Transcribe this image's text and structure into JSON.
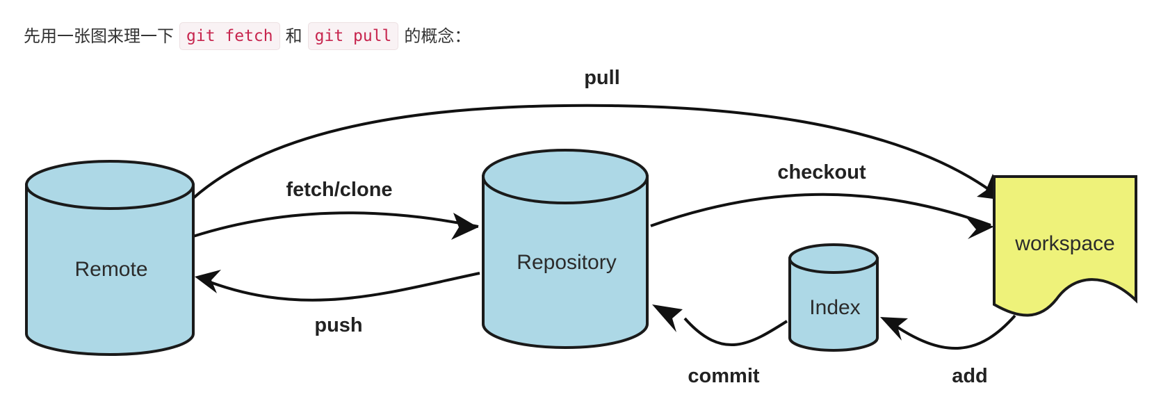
{
  "intro": {
    "prefix": "先用一张图来理一下",
    "code_fetch": "git fetch",
    "conjunction": "和",
    "code_pull": "git pull",
    "suffix": "的概念："
  },
  "nodes": {
    "remote": "Remote",
    "repository": "Repository",
    "index": "Index",
    "workspace": "workspace"
  },
  "edges": {
    "pull": "pull",
    "fetch_clone": "fetch/clone",
    "push": "push",
    "checkout": "checkout",
    "commit": "commit",
    "add": "add"
  },
  "colors": {
    "cylinder_fill": "#add8e6",
    "workspace_fill": "#eef27a",
    "stroke": "#1a1a1a",
    "code_text": "#c7254e",
    "code_bg": "#f9f2f4"
  }
}
